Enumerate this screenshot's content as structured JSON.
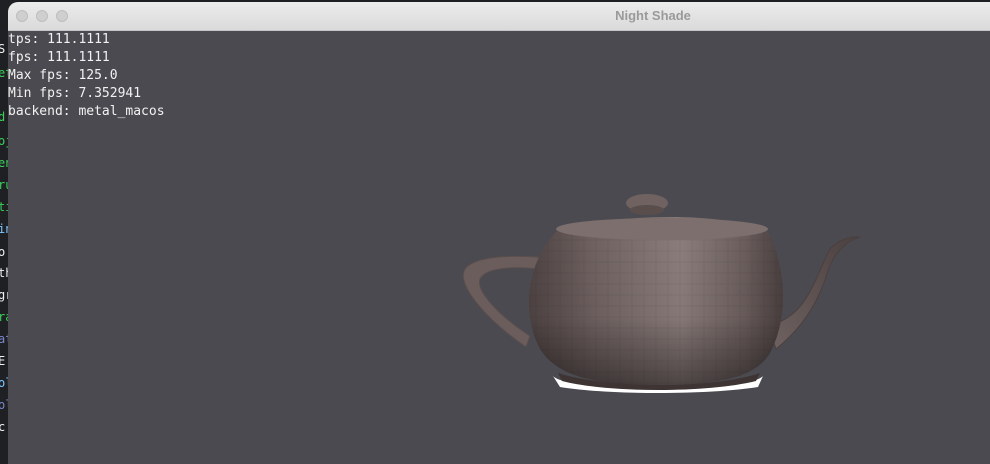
{
  "window": {
    "title": "Night Shade"
  },
  "stats": {
    "tps": "tps: 111.1111",
    "fps": "fps: 111.1111",
    "max_fps": "Max fps: 125.0",
    "min_fps": "Min fps: 7.352941",
    "backend": "backend: metal_macos"
  },
  "background_editor": {
    "lines": [
      {
        "text": "S",
        "color": "#f0f0f0"
      },
      {
        "text": "et",
        "color": "#3ccf5a"
      },
      {
        "text": "d",
        "color": "#3ccf5a"
      },
      {
        "text": "oj",
        "color": "#3ccf5a"
      },
      {
        "text": "en",
        "color": "#3ccf5a"
      },
      {
        "text": "ru",
        "color": "#3ccf5a"
      },
      {
        "text": "til",
        "color": "#3ccf5a"
      },
      {
        "text": "in",
        "color": "#7ec8ff"
      },
      {
        "text": "o",
        "color": "#f0f0f0"
      },
      {
        "text": "th",
        "color": "#f0f0f0"
      },
      {
        "text": "gr",
        "color": "#f0f0f0"
      },
      {
        "text": "ra",
        "color": "#3ccf5a"
      },
      {
        "text": "at",
        "color": "#7b86c8"
      },
      {
        "text": "E",
        "color": "#f0f0f0"
      },
      {
        "text": "ol",
        "color": "#7ec8ff"
      },
      {
        "text": "ol",
        "color": "#7b86c8"
      },
      {
        "text": "c",
        "color": "#f0f0f0"
      }
    ]
  },
  "colors": {
    "viewport_bg": "#4a4a50",
    "teapot_light": "#8a7b79",
    "teapot_dark": "#4a3f3e"
  }
}
